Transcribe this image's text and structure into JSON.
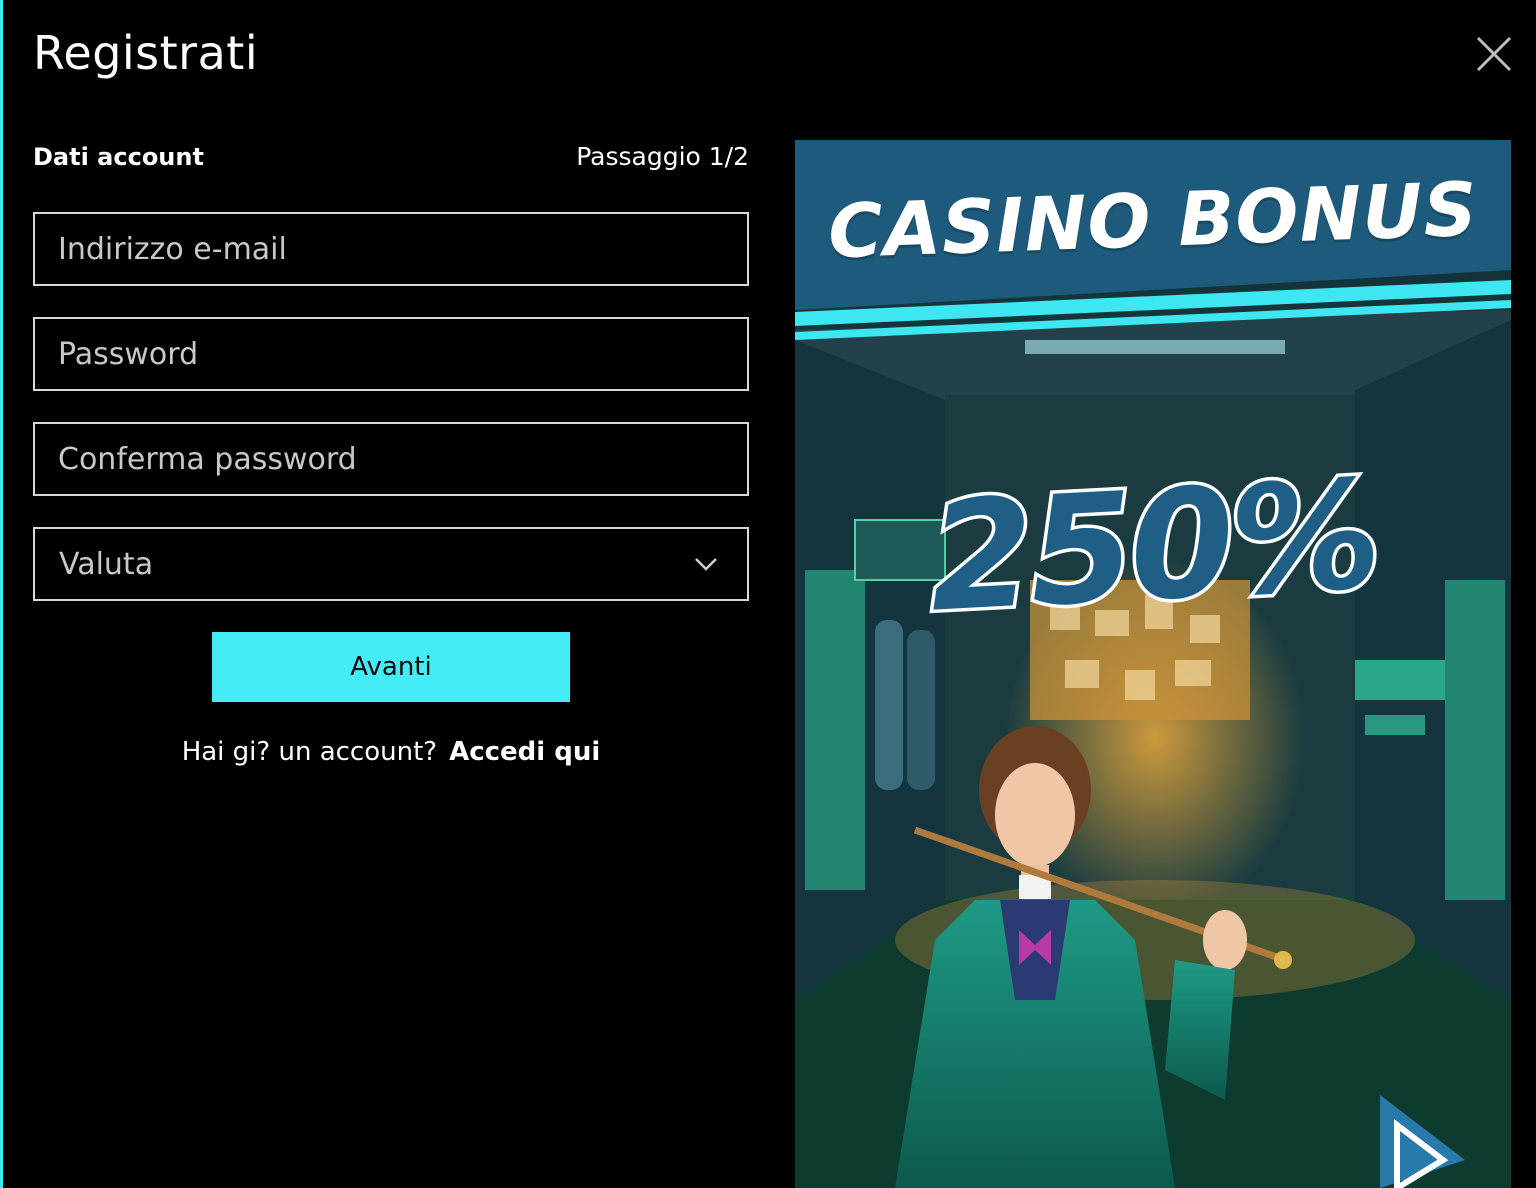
{
  "dialog": {
    "title": "Registrati",
    "close_icon": "close-icon"
  },
  "form": {
    "section_label": "Dati account",
    "step": "Passaggio 1/2",
    "email_placeholder": "Indirizzo e-mail",
    "password_placeholder": "Password",
    "confirm_password_placeholder": "Conferma password",
    "currency_label": "Valuta",
    "next_button": "Avanti",
    "login_prompt": "Hai gi? un account?",
    "login_link": "Accedi qui"
  },
  "promo": {
    "title": "CASINO BONUS",
    "percent": "250%",
    "play_icon": "play-triangle-icon"
  },
  "colors": {
    "accent": "#44ecf5",
    "background": "#000000",
    "banner_blue": "#1f5f86"
  }
}
